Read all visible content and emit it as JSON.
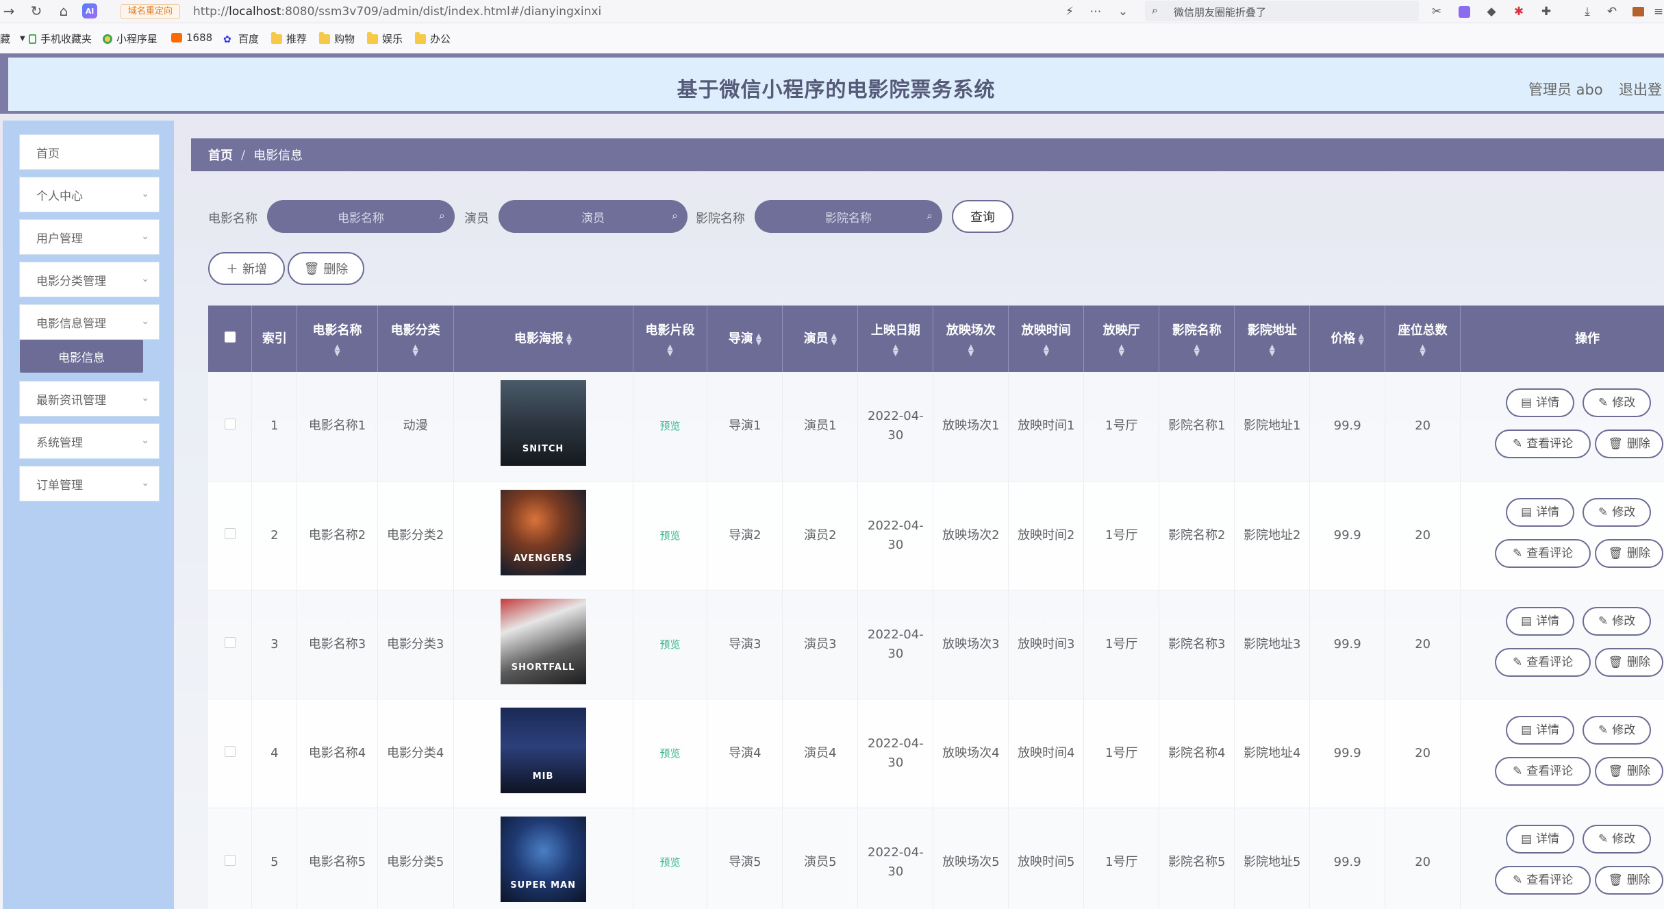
{
  "browser": {
    "redirect_tag": "域名重定向",
    "url_prefix": "http://",
    "url_host": "localhost",
    "url_rest": ":8080/ssm3v709/admin/dist/index.html#/dianyingxinxi",
    "search_placeholder": "微信朋友圈能折叠了",
    "ai_badge": "AI"
  },
  "bookmarks": [
    {
      "label": "手机收藏夹",
      "icon": "phone-icon"
    },
    {
      "label": "小程序星",
      "icon": "miniprogram-icon"
    },
    {
      "label": "1688",
      "icon": "1688-icon"
    },
    {
      "label": "百度",
      "icon": "baidu-icon"
    },
    {
      "label": "推荐",
      "icon": "folder-icon"
    },
    {
      "label": "购物",
      "icon": "folder-icon"
    },
    {
      "label": "娱乐",
      "icon": "folder-icon"
    },
    {
      "label": "办公",
      "icon": "folder-icon"
    }
  ],
  "bookmarks_prefix": "藏",
  "header": {
    "title": "基于微信小程序的电影院票务系统",
    "admin": "管理员 abo",
    "logout": "退出登"
  },
  "sidebar": {
    "items": [
      {
        "label": "首页",
        "has_chevron": false
      },
      {
        "label": "个人中心",
        "has_chevron": true
      },
      {
        "label": "用户管理",
        "has_chevron": true
      },
      {
        "label": "电影分类管理",
        "has_chevron": true
      },
      {
        "label": "电影信息管理",
        "has_chevron": true
      },
      {
        "label": "最新资讯管理",
        "has_chevron": true
      },
      {
        "label": "系统管理",
        "has_chevron": true
      },
      {
        "label": "订单管理",
        "has_chevron": true
      }
    ],
    "active_sub": "电影信息"
  },
  "breadcrumb": {
    "home": "首页",
    "separator": "/",
    "current": "电影信息"
  },
  "search": {
    "fields": [
      {
        "label": "电影名称",
        "placeholder": "电影名称"
      },
      {
        "label": "演员",
        "placeholder": "演员"
      },
      {
        "label": "影院名称",
        "placeholder": "影院名称"
      }
    ],
    "query_button": "查询"
  },
  "actions": {
    "add": "新增",
    "delete": "删除"
  },
  "table": {
    "columns": [
      "索引",
      "电影名称",
      "电影分类",
      "电影海报",
      "电影片段",
      "导演",
      "演员",
      "上映日期",
      "放映场次",
      "放映时间",
      "放映厅",
      "影院名称",
      "影院地址",
      "价格",
      "座位总数",
      "操作"
    ],
    "row_buttons": {
      "detail": "详情",
      "edit": "修改",
      "comments": "查看评论",
      "delete": "删除"
    },
    "rows": [
      {
        "index": "1",
        "name": "电影名称1",
        "category": "动漫",
        "poster_text": "SNITCH",
        "clip": "预览",
        "director": "导演1",
        "actor": "演员1",
        "date": "2022-04-30",
        "session": "放映场次1",
        "time": "放映时间1",
        "hall": "1号厅",
        "cinema": "影院名称1",
        "address": "影院地址1",
        "price": "99.9",
        "seats": "20"
      },
      {
        "index": "2",
        "name": "电影名称2",
        "category": "电影分类2",
        "poster_text": "AVENGERS",
        "clip": "预览",
        "director": "导演2",
        "actor": "演员2",
        "date": "2022-04-30",
        "session": "放映场次2",
        "time": "放映时间2",
        "hall": "1号厅",
        "cinema": "影院名称2",
        "address": "影院地址2",
        "price": "99.9",
        "seats": "20"
      },
      {
        "index": "3",
        "name": "电影名称3",
        "category": "电影分类3",
        "poster_text": "SHORTFALL",
        "clip": "预览",
        "director": "导演3",
        "actor": "演员3",
        "date": "2022-04-30",
        "session": "放映场次3",
        "time": "放映时间3",
        "hall": "1号厅",
        "cinema": "影院名称3",
        "address": "影院地址3",
        "price": "99.9",
        "seats": "20"
      },
      {
        "index": "4",
        "name": "电影名称4",
        "category": "电影分类4",
        "poster_text": "MIB",
        "clip": "预览",
        "director": "导演4",
        "actor": "演员4",
        "date": "2022-04-30",
        "session": "放映场次4",
        "time": "放映时间4",
        "hall": "1号厅",
        "cinema": "影院名称4",
        "address": "影院地址4",
        "price": "99.9",
        "seats": "20"
      },
      {
        "index": "5",
        "name": "电影名称5",
        "category": "电影分类5",
        "poster_text": "SUPER MAN",
        "clip": "预览",
        "director": "导演5",
        "actor": "演员5",
        "date": "2022-04-30",
        "session": "放映场次5",
        "time": "放映时间5",
        "hall": "1号厅",
        "cinema": "影院名称5",
        "address": "影院地址5",
        "price": "99.9",
        "seats": "20"
      }
    ]
  },
  "colors": {
    "primary": "#6c6c97",
    "header_bg": "#dfeefc",
    "sidebar_bg": "#b4cff1",
    "preview_link": "#3cb78c"
  }
}
